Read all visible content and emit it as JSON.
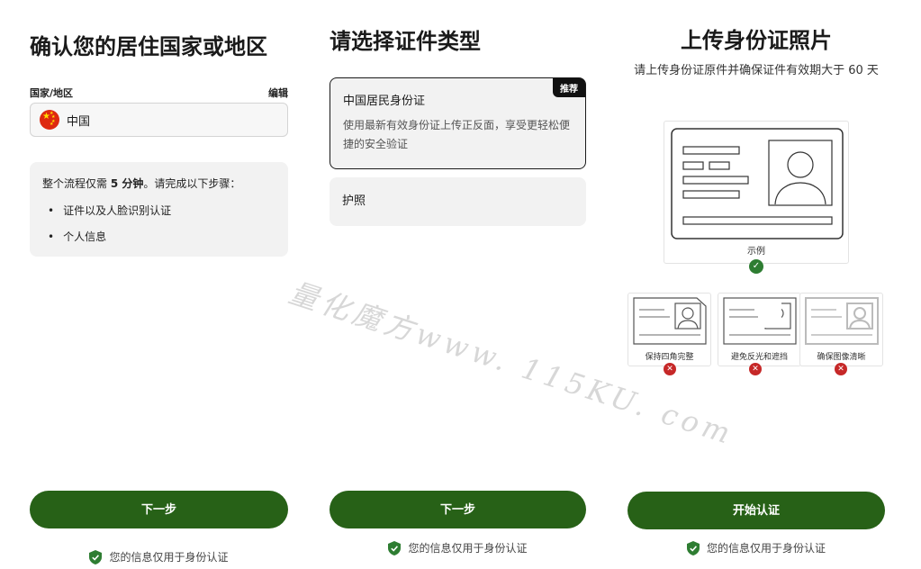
{
  "panel1": {
    "title": "确认您的居住国家或地区",
    "field_label": "国家/地区",
    "edit_label": "编辑",
    "country_value": "中国",
    "info_prefix": "整个流程仅需 ",
    "info_bold": "5 分钟",
    "info_suffix": "。请完成以下步骤：",
    "steps": [
      "证件以及人脸识别认证",
      "个人信息"
    ],
    "next_button": "下一步",
    "secure_text": "您的信息仅用于身份认证"
  },
  "panel2": {
    "title": "请选择证件类型",
    "options": [
      {
        "title": "中国居民身份证",
        "desc": "使用最新有效身份证上传正反面，享受更轻松便捷的安全验证",
        "badge": "推荐"
      },
      {
        "title": "护照"
      }
    ],
    "next_button": "下一步",
    "secure_text": "您的信息仅用于身份认证"
  },
  "panel3": {
    "title": "上传身份证照片",
    "subtitle": "请上传身份证原件并确保证件有效期大于 60 天",
    "example_label": "示例",
    "bad_examples": [
      "保持四角完整",
      "避免反光和遮挡",
      "确保图像清晰"
    ],
    "start_button": "开始认证",
    "secure_text": "您的信息仅用于身份认证"
  },
  "watermark": "量化魔方www. 115KU. com",
  "colors": {
    "primary": "#276117",
    "success": "#2e7d32",
    "error": "#c62828",
    "badge": "#111111"
  },
  "icons": [
    "china-flag-icon",
    "shield-check-icon",
    "check-icon",
    "close-icon",
    "avatar-icon"
  ]
}
